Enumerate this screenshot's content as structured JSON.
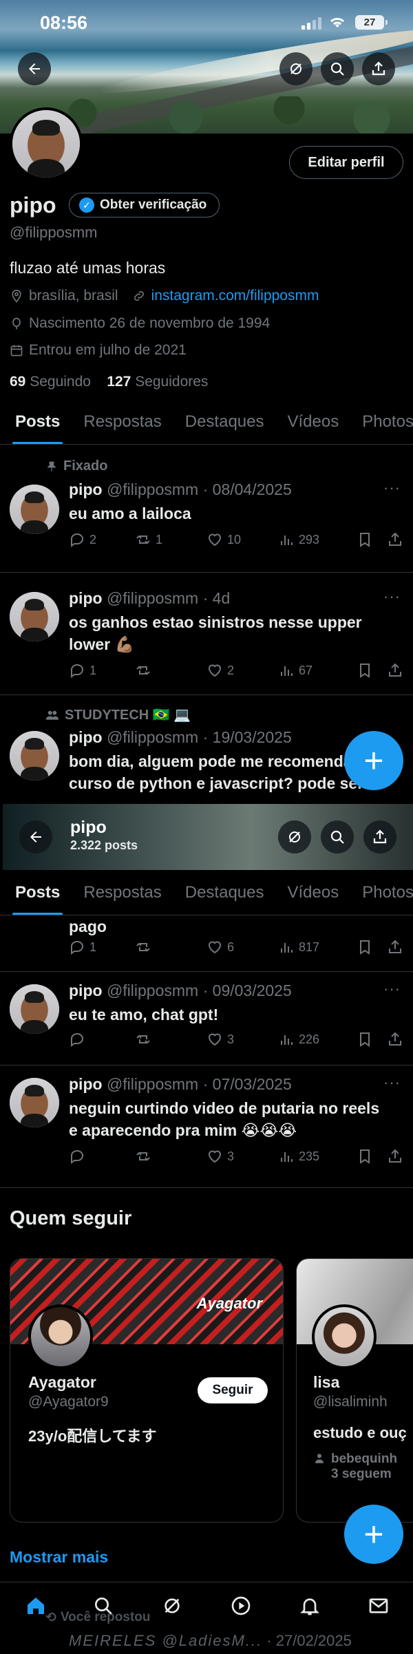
{
  "status_bar": {
    "time": "08:56",
    "battery": "27"
  },
  "profile": {
    "name": "pipo",
    "verify_label": "Obter verificação",
    "handle": "@filipposmm",
    "bio": "fluzao até umas horas",
    "location": "brasília, brasil",
    "link": "instagram.com/filipposmm",
    "birth": "Nascimento 26 de novembro de 1994",
    "joined": "Entrou em julho de 2021",
    "following_count": "69",
    "following_label": "Seguindo",
    "followers_count": "127",
    "followers_label": "Seguidores",
    "edit_label": "Editar perfil"
  },
  "tabs": [
    "Posts",
    "Respostas",
    "Destaques",
    "Vídeos",
    "Photos"
  ],
  "posts": [
    {
      "context": "Fixado",
      "name": "pipo",
      "handle": "@filipposmm",
      "sep": "·",
      "date": "08/04/2025",
      "text": "eu amo a lailoca",
      "replies": "2",
      "reposts": "1",
      "likes": "10",
      "views": "293"
    },
    {
      "name": "pipo",
      "handle": "@filipposmm",
      "sep": "·",
      "date": "4d",
      "text": "os ganhos estao sinistros nesse upper lower 💪🏽",
      "replies": "1",
      "reposts": "",
      "likes": "2",
      "views": "67"
    },
    {
      "context": "STUDYTECH 🇧🇷 💻",
      "name": "pipo",
      "handle": "@filipposmm",
      "sep": "·",
      "date": "19/03/2025",
      "text": "bom dia, alguem pode me recomendar curso de python e javascript? pode ser"
    }
  ],
  "sticky_header": {
    "name": "pipo",
    "count": "2.322 posts"
  },
  "posts_lower": [
    {
      "text": "pago",
      "replies": "1",
      "reposts": "",
      "likes": "6",
      "views": "817"
    },
    {
      "name": "pipo",
      "handle": "@filipposmm",
      "sep": "·",
      "date": "09/03/2025",
      "text": "eu te amo, chat gpt!",
      "replies": "",
      "reposts": "",
      "likes": "3",
      "views": "226"
    },
    {
      "name": "pipo",
      "handle": "@filipposmm",
      "sep": "·",
      "date": "07/03/2025",
      "text": "neguin curtindo video de putaria no reels e aparecendo pra mim 😭😭😭",
      "replies": "",
      "reposts": "",
      "likes": "3",
      "views": "235"
    }
  ],
  "who_to_follow": {
    "title": "Quem seguir",
    "cards": [
      {
        "name": "Ayagator",
        "handle": "@Ayagator9",
        "bio": "23y/o配信してます",
        "cover_text": "Ayagator",
        "follow_label": "Seguir"
      },
      {
        "name": "lisa",
        "handle": "@lisaliminh",
        "bio": "estudo e ouç",
        "followers_line": "bebequinh",
        "followers_count": "3 seguem"
      }
    ],
    "show_more": "Mostrar mais"
  },
  "repost_peek": {
    "label": "Você repostou",
    "author": "MEIRELES @LadiesM...",
    "date": "· 27/02/2025"
  },
  "colors": {
    "accent": "#1d9bf0",
    "background": "#000000",
    "muted": "#71767b",
    "text": "#e7e9ea",
    "border": "#2f3336"
  }
}
